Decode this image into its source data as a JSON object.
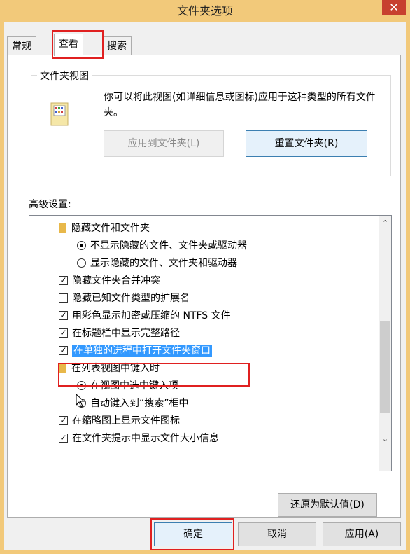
{
  "window": {
    "title": "文件夹选项",
    "close_label": "✕"
  },
  "tabs": [
    {
      "label": "常规"
    },
    {
      "label": "查看"
    },
    {
      "label": "搜索"
    }
  ],
  "folder_view": {
    "group_title": "文件夹视图",
    "description": "你可以将此视图(如详细信息或图标)应用于这种类型的所有文件夹。",
    "apply_button": "应用到文件夹(L)",
    "reset_button": "重置文件夹(R)"
  },
  "advanced": {
    "label": "高级设置:",
    "items": [
      {
        "type": "folder",
        "label": "隐藏文件和文件夹"
      },
      {
        "type": "radio",
        "checked": true,
        "label": "不显示隐藏的文件、文件夹或驱动器"
      },
      {
        "type": "radio",
        "checked": false,
        "label": "显示隐藏的文件、文件夹和驱动器"
      },
      {
        "type": "checkbox",
        "checked": true,
        "label": "隐藏文件夹合并冲突"
      },
      {
        "type": "checkbox",
        "checked": false,
        "label": "隐藏已知文件类型的扩展名"
      },
      {
        "type": "checkbox",
        "checked": true,
        "label": "用彩色显示加密或压缩的 NTFS 文件"
      },
      {
        "type": "checkbox",
        "checked": true,
        "label": "在标题栏中显示完整路径"
      },
      {
        "type": "checkbox",
        "checked": true,
        "label": "在单独的进程中打开文件夹窗口"
      },
      {
        "type": "folder",
        "label": "在列表视图中键入时"
      },
      {
        "type": "radio",
        "checked": true,
        "label": "在视图中选中键入项"
      },
      {
        "type": "radio",
        "checked": false,
        "label": "自动键入到“搜索”框中"
      },
      {
        "type": "checkbox",
        "checked": true,
        "label": "在缩略图上显示文件图标"
      },
      {
        "type": "checkbox",
        "checked": true,
        "label": "在文件夹提示中显示文件大小信息"
      }
    ],
    "restore_button": "还原为默认值(D)"
  },
  "footer": {
    "ok": "确定",
    "cancel": "取消",
    "apply": "应用(A)"
  },
  "colors": {
    "titlebar": "#f2c97a",
    "highlight": "#e02020",
    "selection": "#3399ff"
  }
}
